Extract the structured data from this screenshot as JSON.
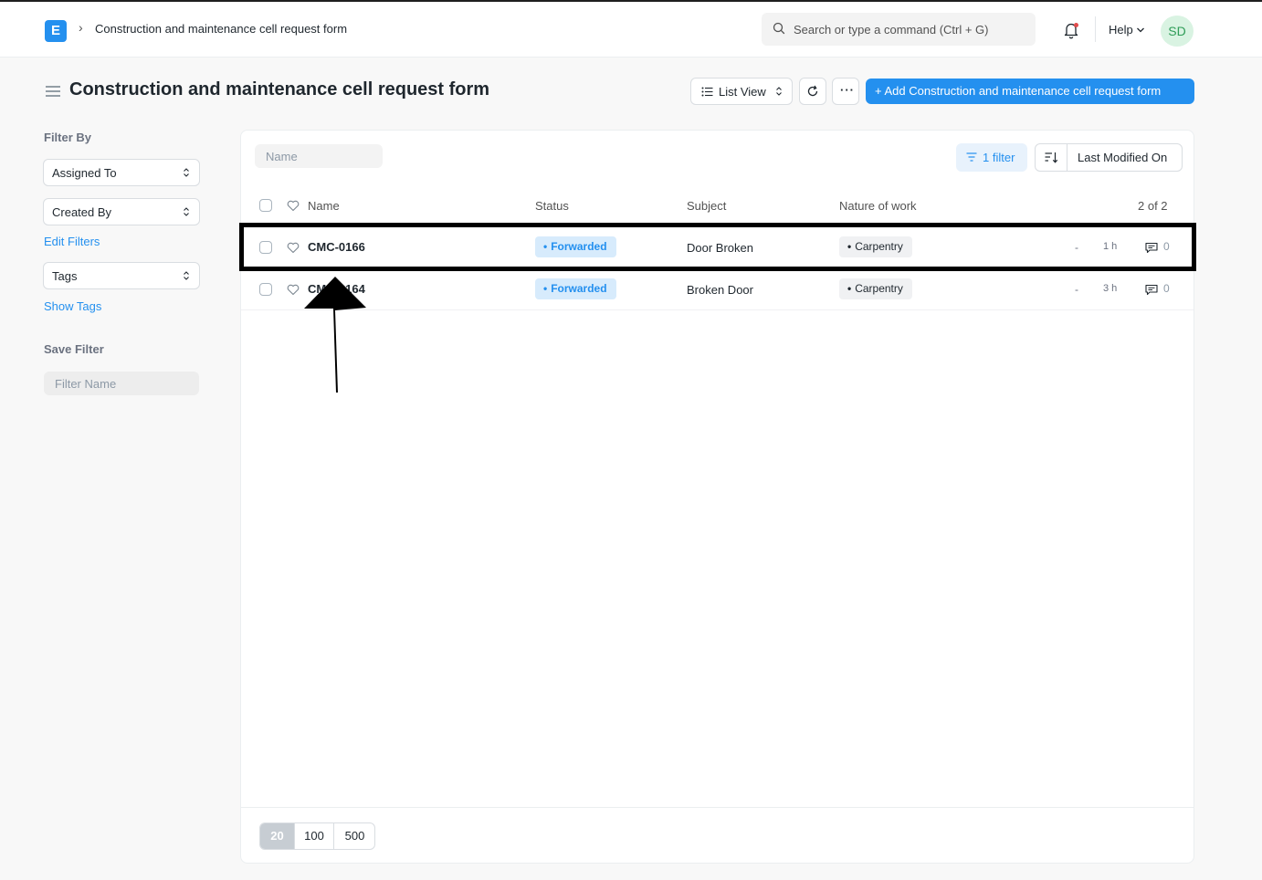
{
  "navbar": {
    "logo_letter": "E",
    "breadcrumb": "Construction and maintenance cell request form",
    "search_placeholder": "Search or type a command (Ctrl + G)",
    "help_label": "Help",
    "avatar_initials": "SD"
  },
  "page": {
    "title": "Construction and maintenance cell request form",
    "list_view_label": "List View",
    "more_label": "···",
    "primary_button": "+ Add Construction and maintenance cell request form"
  },
  "sidebar": {
    "filter_by": "Filter By",
    "assigned_to": "Assigned To",
    "created_by": "Created By",
    "edit_filters": "Edit Filters",
    "tags": "Tags",
    "show_tags": "Show Tags",
    "save_filter": "Save Filter",
    "filter_name_placeholder": "Filter Name"
  },
  "list": {
    "name_placeholder": "Name",
    "filter_label": "1 filter",
    "sort_label": "Last Modified On",
    "columns": {
      "name": "Name",
      "status": "Status",
      "subject": "Subject",
      "nature": "Nature of work"
    },
    "count": "2 of 2",
    "rows": [
      {
        "name": "CMC-0166",
        "status": "Forwarded",
        "subject": "Door Broken",
        "nature": "Carpentry",
        "dash": "-",
        "time": "1 h",
        "comments": "0"
      },
      {
        "name": "CMC-0164",
        "status": "Forwarded",
        "subject": "Broken Door",
        "nature": "Carpentry",
        "dash": "-",
        "time": "3 h",
        "comments": "0"
      }
    ],
    "page_sizes": [
      "20",
      "100",
      "500"
    ]
  },
  "colors": {
    "accent": "#2490ef",
    "status_bg": "#d7ebfc",
    "annotation": "#000000"
  }
}
